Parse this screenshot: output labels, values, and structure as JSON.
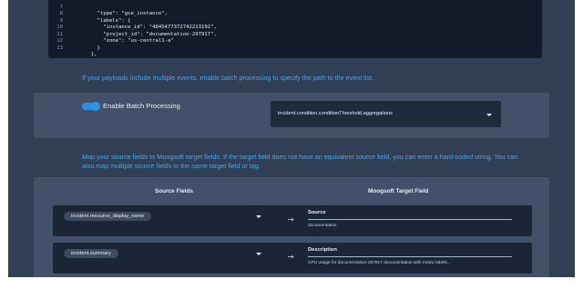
{
  "code_block": {
    "lines": [
      {
        "num": "7",
        "text": "    \"type\": \"gce_instance\","
      },
      {
        "num": "8",
        "text": "    \"labels\": {"
      },
      {
        "num": "9",
        "text": "      \"instance_id\": \"4845477372742213192\","
      },
      {
        "num": "10",
        "text": "      \"project_id\": \"documentation-297917\","
      },
      {
        "num": "11",
        "text": "      \"zone\": \"us-central1-a\""
      },
      {
        "num": "12",
        "text": "    }"
      },
      {
        "num": "13",
        "text": "  },"
      }
    ]
  },
  "batch_hint": "If your payloads include multiple events, enable batch processing to specify the path to the event list.",
  "batch": {
    "toggle_label": "Enable Batch Processing",
    "toggle_on": true,
    "path_value": "incident.condition.conditionThreshold.aggregations"
  },
  "mapping_hint": "Map your source fields to Moogsoft target fields. If the target field does not have an equivalent source field, you can enter a hard-coded string. You can also map multiple source fields to the same target field or tag.",
  "mapping": {
    "source_header": "Source Fields",
    "target_header": "Moogsoft Target Field",
    "rows": [
      {
        "source": "incident.resource_display_name",
        "target": "Source",
        "value": "documentation"
      },
      {
        "source": "incident.summary",
        "target": "Description",
        "value": "CPU usage for documentation-297917 documentation with metric labels..."
      }
    ]
  },
  "colors": {
    "background": "#313f56",
    "panel": "#42506a",
    "accent": "#2d8ee0",
    "hint_text": "#4aa3e6",
    "code_bg": "#111b2a"
  },
  "icons": {
    "select_chevron": "chevron-down-icon",
    "mapping_arrow": "arrow-right-icon"
  }
}
